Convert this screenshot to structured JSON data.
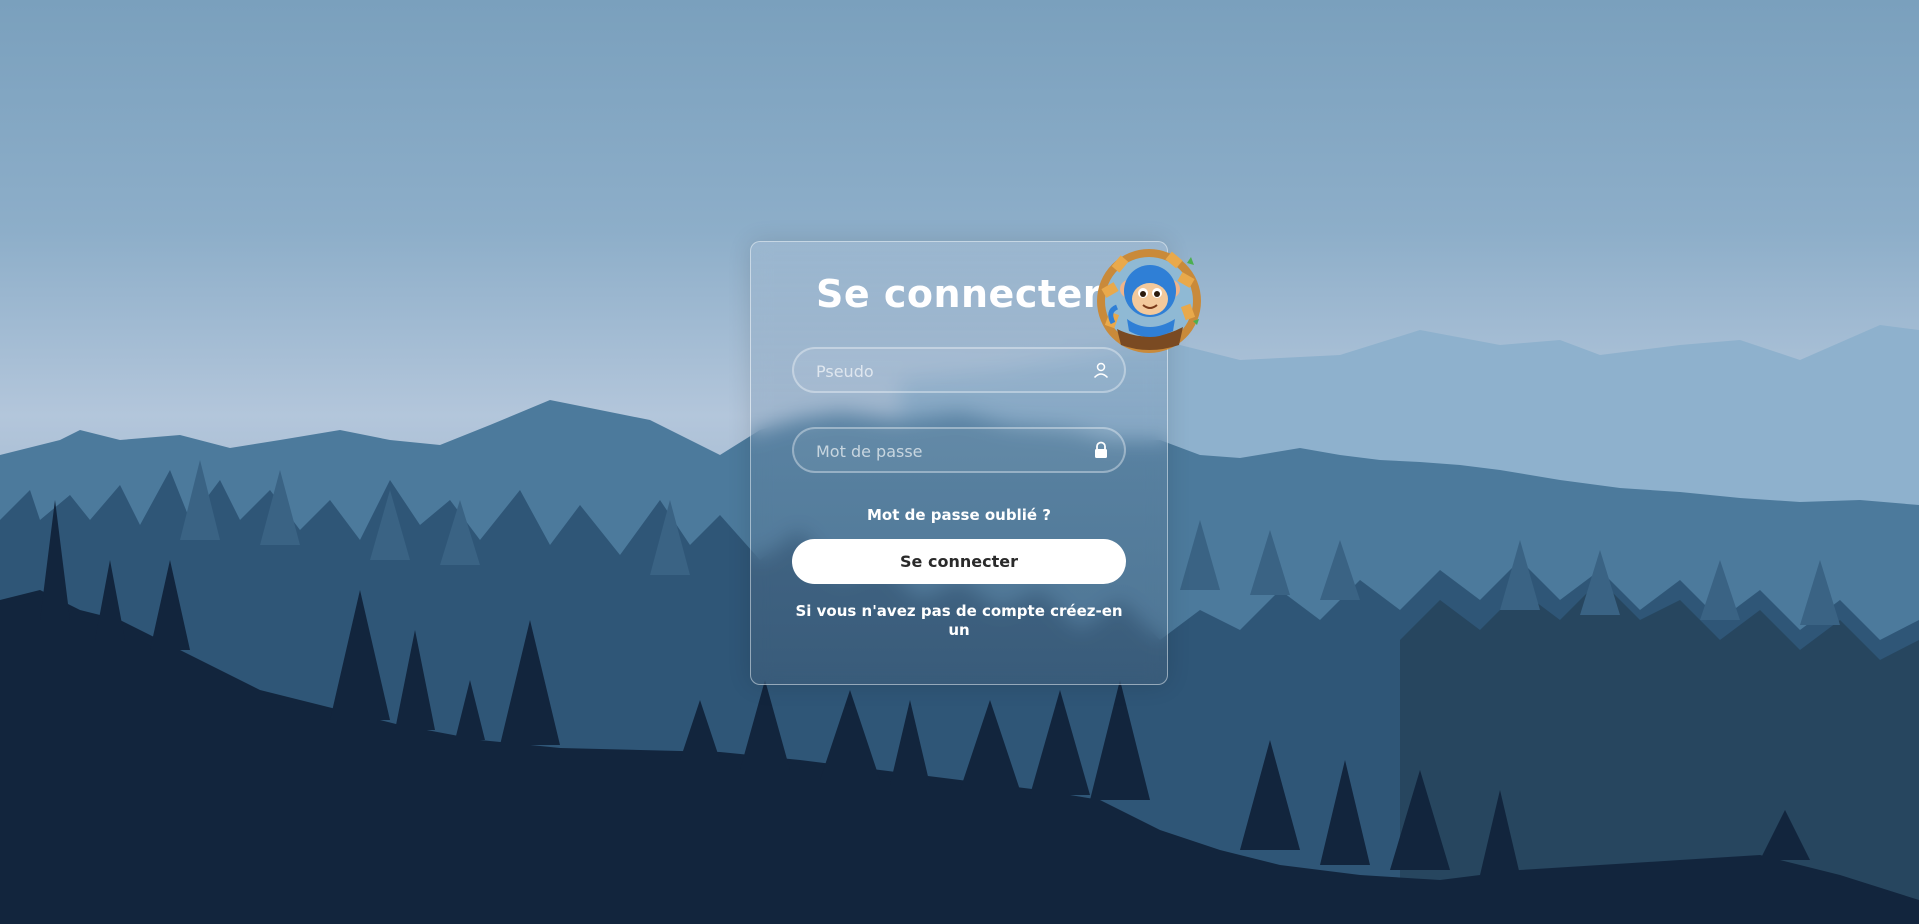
{
  "login": {
    "title": "Se connecter",
    "username_placeholder": "Pseudo",
    "password_placeholder": "Mot de passe",
    "forgot_password": "Mot de passe oublié ?",
    "submit_label": "Se connecter",
    "signup_text": "Si vous n'avez pas de compte créez-en un"
  },
  "icons": {
    "username": "user-icon",
    "password": "lock-icon",
    "mascot": "monkey-mascot-icon"
  },
  "colors": {
    "sky": "#7aa0bd",
    "mountains_far": "#8eb1cd",
    "mountains_mid": "#4c7a9c",
    "forest_mid": "#2f5677",
    "forest_front": "#12253d",
    "button_bg": "#ffffff",
    "button_text": "#2a2a2a"
  }
}
